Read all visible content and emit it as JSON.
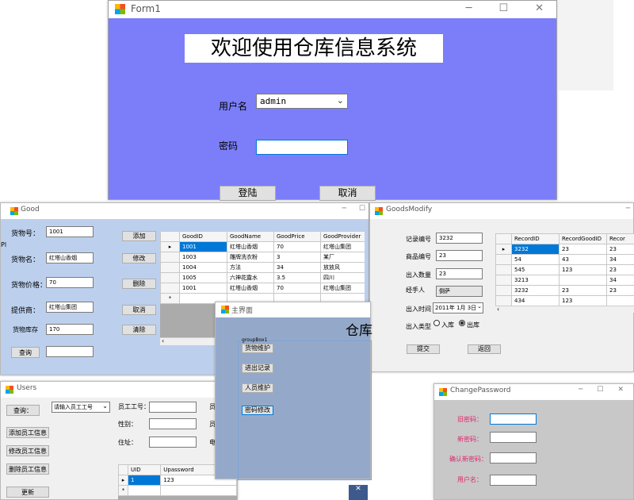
{
  "colors": {
    "login_bg": "#7b7ef8",
    "good_bg": "#bcd0ee",
    "main_bg": "#94a9c9",
    "pwd_bg": "#c8c8c8",
    "pink_label": "#e0246c",
    "select_blue": "#0078d7"
  },
  "form1": {
    "title": "Form1",
    "banner": "欢迎使用仓库信息系统",
    "user_label": "用户名",
    "user_value": "admin",
    "pwd_label": "密码",
    "login_btn": "登陆",
    "cancel_btn": "取消"
  },
  "good": {
    "title": "Good",
    "labels": [
      "货物号：",
      "货物名：",
      "货物价格：",
      "提供商：",
      "货物库存"
    ],
    "values": [
      "1001",
      "红塔山香烟",
      "70",
      "红塔山集团",
      "170"
    ],
    "buttons": [
      "添加",
      "修改",
      "删除",
      "取消",
      "清除"
    ],
    "query_btn": "查询",
    "table": {
      "headers": [
        "GoodID",
        "GoodName",
        "GoodPrice",
        "GoodProvider"
      ],
      "rows": [
        [
          "1001",
          "红塔山香烟",
          "70",
          "红塔山集团"
        ],
        [
          "1003",
          "雕牌洗衣粉",
          "3",
          "某厂"
        ],
        [
          "1004",
          "方法",
          "34",
          "放放风"
        ],
        [
          "1005",
          "六神花露水",
          "3.5",
          "四川"
        ],
        [
          "1001",
          "红塔山香烟",
          "70",
          "红塔山集团"
        ]
      ]
    }
  },
  "goodsmodify": {
    "title": "GoodsModify",
    "labels": [
      "记录编号",
      "商品编号",
      "出入数量",
      "经手人",
      "出入时间",
      "出入类型"
    ],
    "values": [
      "3232",
      "23",
      "23",
      "倒萨"
    ],
    "date": "2011年  1月  3日",
    "radio_in": "入库",
    "radio_out": "出库",
    "submit_btn": "提交",
    "back_btn": "返回",
    "table": {
      "headers": [
        "RecordID",
        "RecordGoodID",
        "Recor"
      ],
      "rows": [
        [
          "3232",
          "23",
          "23"
        ],
        [
          "54",
          "43",
          "34"
        ],
        [
          "545",
          "123",
          "23"
        ],
        [
          "3213",
          "",
          "34"
        ],
        [
          "3232",
          "23",
          "23"
        ],
        [
          "434",
          "123",
          ""
        ]
      ]
    }
  },
  "main": {
    "title": "主界面",
    "banner": "仓库",
    "group": "groupBox1",
    "buttons": [
      "货物维护",
      "进出记录",
      "人员维护",
      "密码修改"
    ]
  },
  "users": {
    "title": "Users",
    "query_btn": "查询：",
    "combo": "请输入员工工号",
    "labels": [
      "员工工号：",
      "性别：",
      "住址："
    ],
    "right_labels": [
      "员",
      "员",
      "电"
    ],
    "buttons": [
      "添加员工信息",
      "修改员工信息",
      "删除员工信息",
      "更新"
    ],
    "table": {
      "headers": [
        "UID",
        "Upassword"
      ],
      "rows": [
        [
          "1",
          "123"
        ]
      ]
    }
  },
  "changepwd": {
    "title": "ChangePassword",
    "labels": [
      "旧密码：",
      "新密码：",
      "确认新密码：",
      "用户名："
    ]
  },
  "misc": {
    "pl": "Pl"
  }
}
